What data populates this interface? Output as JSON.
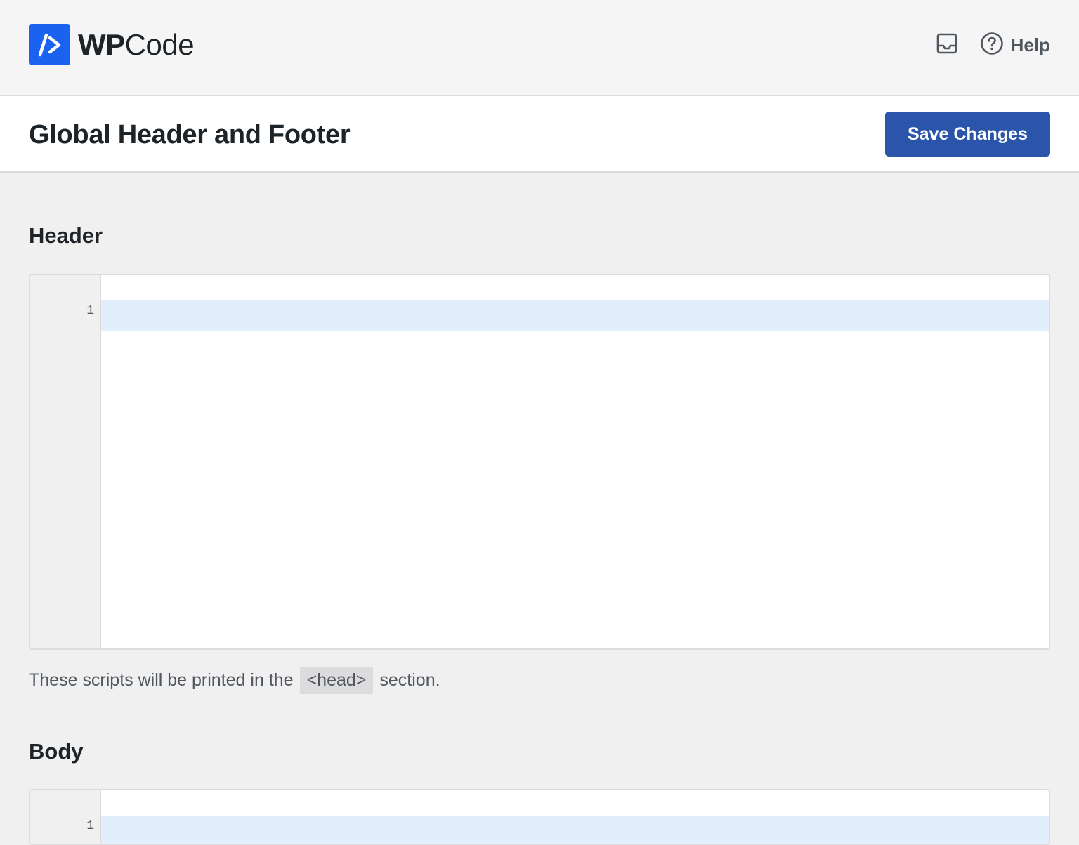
{
  "brand": {
    "name_bold": "WP",
    "name_regular": "Code",
    "accent_color": "#1a62f0",
    "icon": "code-slash-icon"
  },
  "topbar": {
    "inbox_icon": "inbox-icon",
    "help_icon": "question-circle-icon",
    "help_label": "Help"
  },
  "page": {
    "title": "Global Header and Footer",
    "save_label": "Save Changes",
    "save_color": "#2b54ab"
  },
  "sections": {
    "header": {
      "heading": "Header",
      "line_number": "1",
      "help_prefix": "These scripts will be printed in the",
      "help_code": "<head>",
      "help_suffix": "section."
    },
    "body": {
      "heading": "Body",
      "line_number": "1"
    }
  }
}
